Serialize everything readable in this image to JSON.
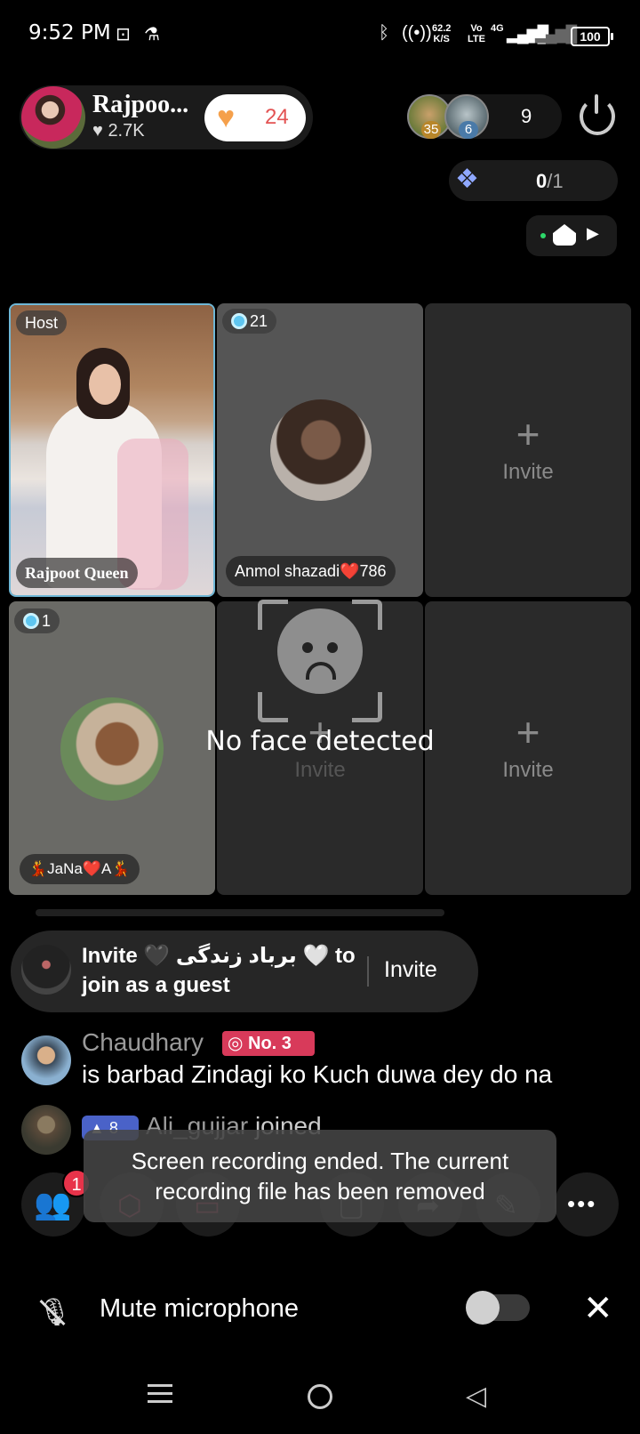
{
  "status_bar": {
    "time": "9:52 PM",
    "net_speed": "62.2",
    "net_unit": "K/S",
    "volte": "Vo",
    "lte": "LTE",
    "net_type": "4G",
    "battery": "100"
  },
  "host": {
    "name": "Rajpoo...",
    "likes": "2.7K",
    "heart_count": "24"
  },
  "viewers": {
    "avatar1_level": "35",
    "avatar2_level": "6",
    "count": "9"
  },
  "gift": {
    "count": "0",
    "total": "/1"
  },
  "seats": [
    {
      "tag": "Host",
      "name": "Rajpoot Queen"
    },
    {
      "level": "21",
      "name": "Anmol shazadi❤️786"
    },
    {
      "plus": "+",
      "label": "Invite"
    },
    {
      "level": "1",
      "name": "💃JaNa❤️A💃"
    },
    {
      "plus": "+",
      "label": "Invite"
    },
    {
      "plus": "+",
      "label": "Invite"
    }
  ],
  "no_face_text": "No face detected",
  "invite_banner": {
    "line1": "Invite 🖤 برباد زندگی 🤍 to",
    "line2": "join as a guest",
    "button": "Invite"
  },
  "chat": [
    {
      "name": "Chaudhary",
      "badge": "No. 3",
      "message": "is barbad Zindagi ko Kuch duwa dey do na"
    },
    {
      "level": "8",
      "name": "Ali_gujjar",
      "message": "joined"
    }
  ],
  "toast": {
    "line1": "Screen recording ended. The current",
    "line2": "recording file has been removed"
  },
  "toolbar": {
    "guest_badge": "1",
    "more": "•••"
  },
  "mute": {
    "label": "Mute microphone"
  },
  "colors": {
    "accent_pink": "#e35353",
    "host_border": "#6fb7d6",
    "badge_red": "#d83a5a"
  }
}
